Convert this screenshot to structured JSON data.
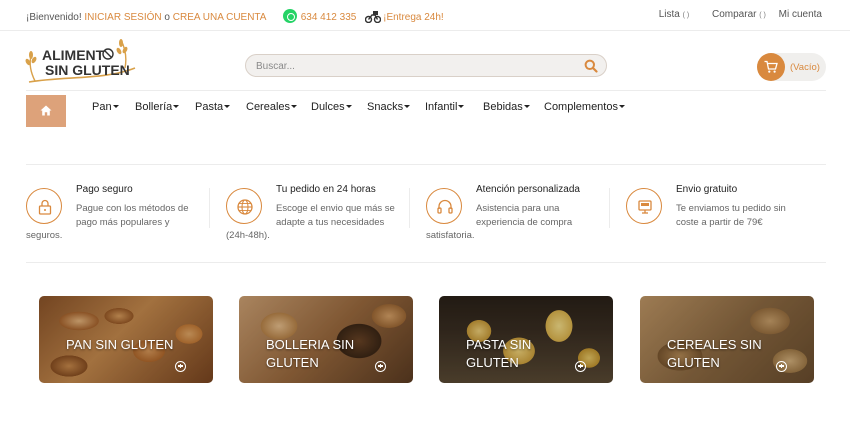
{
  "topbar": {
    "welcome": "¡Bienvenido!",
    "login": "INICIAR SESIÓN",
    "or": "o",
    "register": "CREA UNA CUENTA",
    "phone": "634 412 335",
    "delivery": "¡Entrega 24h!",
    "links": [
      {
        "label": "Lista",
        "count": "( )"
      },
      {
        "label": "Comparar",
        "count": "( )"
      },
      {
        "label": "Mi cuenta",
        "count": ""
      }
    ]
  },
  "logo": {
    "line1": "ALIMENT",
    "line2": "SIN GLUTEN"
  },
  "search": {
    "placeholder": "Buscar..."
  },
  "cart": {
    "label": "(Vacío)"
  },
  "nav": {
    "home_icon": "home-icon",
    "items": [
      {
        "label": "Pan"
      },
      {
        "label": "Bollería"
      },
      {
        "label": "Pasta"
      },
      {
        "label": "Cereales"
      },
      {
        "label": "Dulces"
      },
      {
        "label": "Snacks"
      },
      {
        "label": "Infantil"
      },
      {
        "label": "Bebidas"
      },
      {
        "label": "Complementos"
      }
    ]
  },
  "features": [
    {
      "icon": "lock-icon",
      "title": "Pago seguro",
      "desc": "Pague con los métodos de pago más populares y",
      "desc2": "seguros."
    },
    {
      "icon": "globe-icon",
      "title": "Tu pedido en 24 horas",
      "desc": "Escoge el envio que más se adapte a tus necesidades",
      "desc2": "(24h-48h)."
    },
    {
      "icon": "headset-icon",
      "title": "Atención personalizada",
      "desc": "Asistencia para una experiencia de compra",
      "desc2": "satisfatoria."
    },
    {
      "icon": "monitor-icon",
      "title": "Envio gratuito",
      "desc": "Te enviamos tu pedido sin coste a partir de 79€",
      "desc2": ""
    }
  ],
  "categories": [
    {
      "title": "PAN SIN GLUTEN"
    },
    {
      "title": "BOLLERIA SIN GLUTEN"
    },
    {
      "title": "PASTA SIN GLUTEN"
    },
    {
      "title": "CEREALES SIN GLUTEN"
    }
  ],
  "colors": {
    "accent": "#d9893e",
    "home_button": "#dda27a"
  }
}
